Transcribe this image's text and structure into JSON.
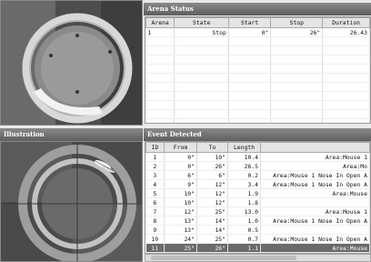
{
  "arena_panel": {
    "title": "Arena Status"
  },
  "arena_table": {
    "columns": [
      "Arena",
      "State",
      "Start",
      "Stop",
      "Duration"
    ],
    "rows": [
      [
        "1",
        "Stop",
        "0\"",
        "26\"",
        "26.43"
      ]
    ]
  },
  "illustration_panel": {
    "title": "Illustration"
  },
  "event_panel": {
    "title": "Event Detected"
  },
  "event_table": {
    "columns": [
      "ID",
      "From",
      "To",
      "Length",
      ""
    ],
    "rows": [
      [
        "1",
        "0\"",
        "10\"",
        "10.4",
        "Area:Mouse 1"
      ],
      [
        "2",
        "0\"",
        "26\"",
        "26.5",
        "Area:Mo"
      ],
      [
        "3",
        "6\"",
        "6\"",
        "0.2",
        "Area:Mouse 1 Nose In Open A"
      ],
      [
        "4",
        "9\"",
        "12\"",
        "3.4",
        "Area:Mouse 1 Nose In Open A"
      ],
      [
        "5",
        "10\"",
        "12\"",
        "1.9",
        "Area:Mouse"
      ],
      [
        "6",
        "10\"",
        "12\"",
        "1.8",
        ""
      ],
      [
        "7",
        "12\"",
        "25\"",
        "13.0",
        "Area:Mouse 1"
      ],
      [
        "8",
        "13\"",
        "14\"",
        "1.0",
        "Area:Mouse 1 Nose In Open A"
      ],
      [
        "9",
        "13\"",
        "14\"",
        "0.5",
        ""
      ],
      [
        "10",
        "24\"",
        "25\"",
        "0.7",
        "Area:Mouse 1 Nose In Open A"
      ],
      [
        "11",
        "25\"",
        "26\"",
        "1.1",
        "Area:Mouse"
      ]
    ],
    "selected_row": 10
  }
}
